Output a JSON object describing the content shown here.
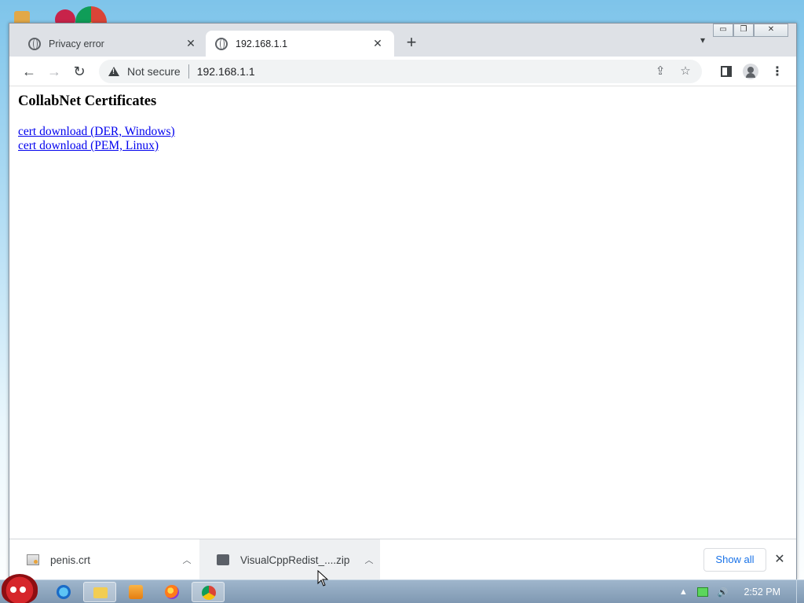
{
  "browser": {
    "tabs": [
      {
        "title": "Privacy error",
        "active": false
      },
      {
        "title": "192.168.1.1",
        "active": true
      }
    ],
    "omnibox": {
      "security_label": "Not secure",
      "url": "192.168.1.1"
    }
  },
  "page": {
    "heading": "CollabNet Certificates",
    "links": [
      {
        "label": "cert download (DER, Windows)"
      },
      {
        "label": "cert download (PEM, Linux)"
      }
    ]
  },
  "downloads": {
    "items": [
      {
        "name": "penis.crt",
        "icon": "certificate-file-icon"
      },
      {
        "name": "VisualCppRedist_....zip",
        "icon": "zip-archive-icon"
      }
    ],
    "show_all_label": "Show all"
  },
  "taskbar": {
    "apps": [
      "internet-explorer",
      "file-explorer",
      "media-player",
      "firefox",
      "chrome"
    ],
    "active_app": "chrome",
    "clock": "2:52 PM"
  },
  "colors": {
    "link": "#0000ee",
    "show_all": "#1a73e8",
    "tabstrip": "#dee1e6"
  }
}
